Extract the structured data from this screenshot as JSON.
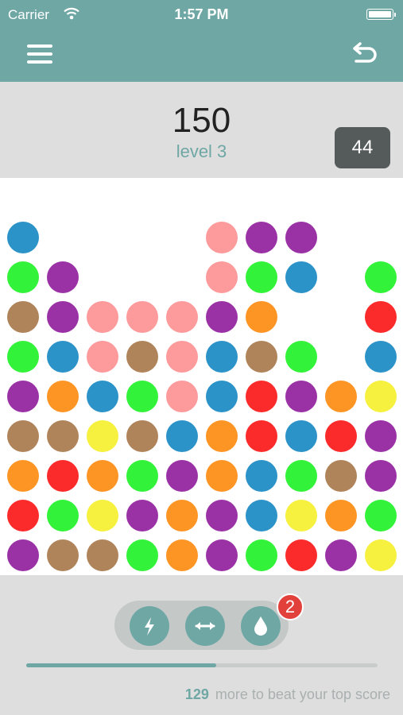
{
  "status_bar": {
    "carrier": "Carrier",
    "time": "1:57 PM",
    "wifi_icon": "wifi-icon",
    "battery_icon": "battery-icon"
  },
  "header": {
    "menu_icon": "hamburger-menu-icon",
    "undo_icon": "undo-icon",
    "background_color": "#6fa7a5"
  },
  "scoreboard": {
    "score": "150",
    "level": "level 3",
    "moves_left": "44"
  },
  "board": {
    "columns": 10,
    "rows": 9,
    "colors": {
      "B": "#2b93c8",
      "P": "#9a32a5",
      "K": "#fc9a9c",
      "G": "#33f23a",
      "N": "#b0845a",
      "O": "#fd9524",
      "R": "#fb2b2b",
      "Y": "#f6f03e"
    },
    "grid": [
      "B....KPP..",
      "GP...KGB.G",
      "NPKKKPO..R",
      "GBKNKBNG.B",
      "POBGKBRPOY",
      "NNYNBORBRP",
      "OROGPOBGNP",
      "RGYPOPBYOG",
      "PNNGOPGRPY"
    ]
  },
  "powerups": {
    "items": [
      {
        "name": "lightning-icon"
      },
      {
        "name": "expand-horizontal-icon"
      },
      {
        "name": "drop-icon"
      }
    ],
    "badge_count": "2"
  },
  "progress": {
    "fraction": 0.54,
    "remaining": "129",
    "message": "more to beat your top score"
  }
}
